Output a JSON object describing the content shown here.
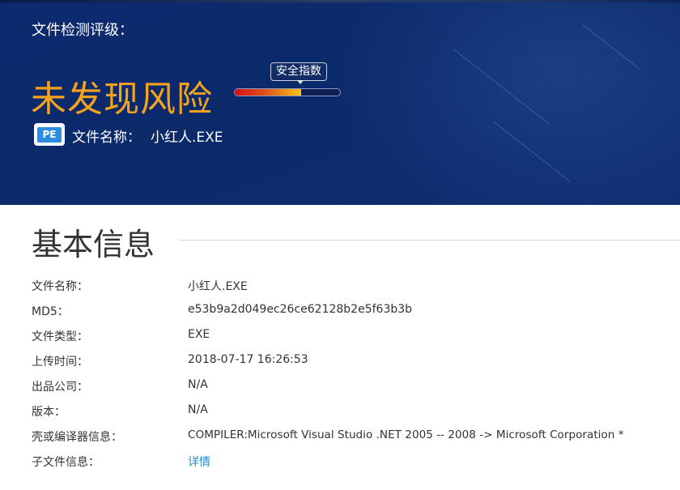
{
  "header": {
    "grade_label": "文件检测评级：",
    "risk_level": "未发现风险",
    "safety_index_tip": "安全指数",
    "safety_index_fraction": 0.63,
    "file_icon": "pe-file-icon",
    "file_icon_text": "PE",
    "file_name_label": "文件名称：",
    "file_name_value": "小红人.EXE"
  },
  "basic_info": {
    "title": "基本信息",
    "rows": [
      {
        "label": "文件名称：",
        "value": "小红人.EXE"
      },
      {
        "label": "MD5：",
        "value": "e53b9a2d049ec26ce62128b2e5f63b3b"
      },
      {
        "label": "文件类型：",
        "value": "EXE"
      },
      {
        "label": "上传时间：",
        "value": "2018-07-17 16:26:53"
      },
      {
        "label": "出品公司：",
        "value": "N/A"
      },
      {
        "label": "版本：",
        "value": "N/A"
      },
      {
        "label": "壳或编译器信息：",
        "value": "COMPILER:Microsoft Visual Studio .NET 2005 -- 2008 -> Microsoft Corporation *"
      },
      {
        "label": "子文件信息：",
        "value": "详情"
      }
    ]
  },
  "colors": {
    "header_bg": "#0d2a6e",
    "risk_text": "#f5a31f",
    "link": "#1a8fd2"
  }
}
